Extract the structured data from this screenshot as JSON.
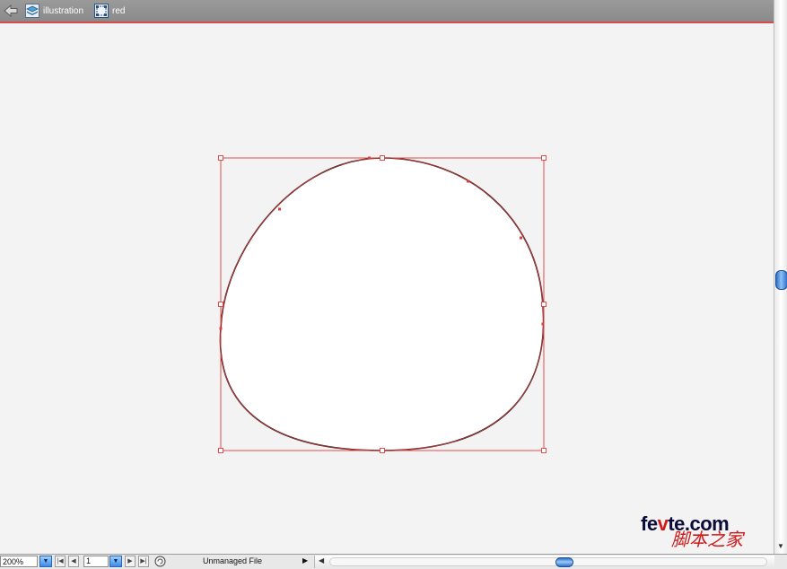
{
  "breadcrumb": {
    "items": [
      {
        "label": "illustration",
        "icon": "layer-stack-icon"
      },
      {
        "label": "red",
        "icon": "group-selection-icon"
      }
    ]
  },
  "status": {
    "zoom": "200%",
    "page": "1",
    "file_status": "Unmanaged File"
  },
  "watermark": {
    "site_pre": "fe",
    "site_v": "v",
    "site_post": "te.com",
    "cn_text": "脚本之家"
  },
  "colors": {
    "selection": "#e23b3b",
    "topbar": "#8f8f8f",
    "canvas": "#f3f3f3",
    "scroll_thumb": "#2f72cc"
  }
}
